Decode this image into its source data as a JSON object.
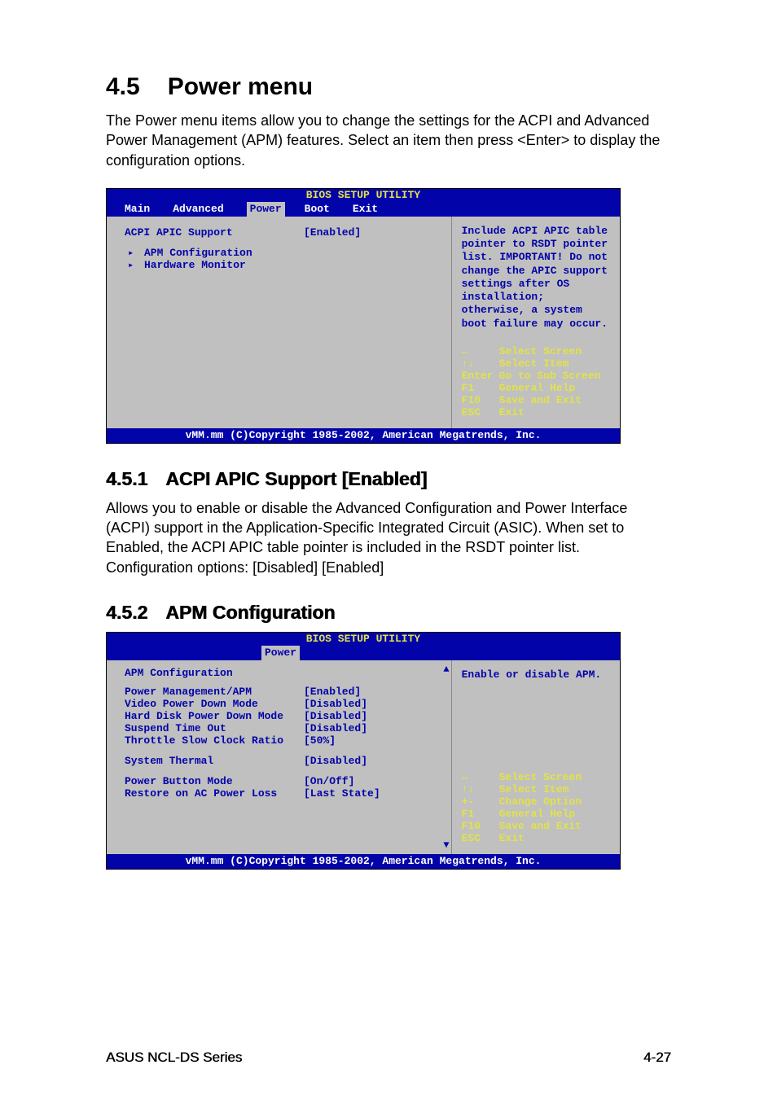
{
  "heading": {
    "number": "4.5",
    "title": "Power menu"
  },
  "intro": "The Power menu items allow you to change the settings for the ACPI and Advanced Power Management (APM) features. Select an item then press <Enter> to display the configuration options.",
  "bios1": {
    "title": "BIOS SETUP UTILITY",
    "tabs": {
      "t0": "Main",
      "t1": "Advanced",
      "t2": "Power",
      "t3": "Boot",
      "t4": "Exit",
      "active": "Power"
    },
    "items": {
      "acpi_label": "ACPI APIC Support",
      "acpi_value": "[Enabled]",
      "sub0": "APM Configuration",
      "sub1": "Hardware Monitor"
    },
    "help": "Include ACPI APIC table pointer to RSDT pointer list. IMPORTANT! Do not change the APIC support settings after OS installation; otherwise, a system boot failure may occur.",
    "nav": {
      "k0": "↔",
      "d0": "Select Screen",
      "k1": "↑↓",
      "d1": "Select Item",
      "k2": "Enter",
      "d2": "Go to Sub Screen",
      "k3": "F1",
      "d3": "General Help",
      "k4": "F10",
      "d4": "Save and Exit",
      "k5": "ESC",
      "d5": "Exit"
    },
    "footer": "vMM.mm (C)Copyright 1985-2002, American Megatrends, Inc."
  },
  "section451": {
    "number": "4.5.1",
    "title": "ACPI APIC Support [Enabled]",
    "body": "Allows you to enable or disable the Advanced Configuration and Power Interface (ACPI) support in the Application-Specific Integrated Circuit (ASIC). When set to Enabled, the ACPI APIC table pointer is included in the RSDT pointer list. Configuration options: [Disabled] [Enabled]"
  },
  "section452": {
    "number": "4.5.2",
    "title": "APM Configuration"
  },
  "bios2": {
    "title": "BIOS SETUP UTILITY",
    "tab": "Power",
    "header": "APM Configuration",
    "items": {
      "l0": "Power Management/APM",
      "v0": "[Enabled]",
      "l1": "Video Power Down Mode",
      "v1": "[Disabled]",
      "l2": "Hard Disk Power Down Mode",
      "v2": "[Disabled]",
      "l3": "Suspend Time Out",
      "v3": "[Disabled]",
      "l4": "Throttle Slow Clock Ratio",
      "v4": "[50%]",
      "l5": "System Thermal",
      "v5": "[Disabled]",
      "l6": "Power Button Mode",
      "v6": "[On/Off]",
      "l7": "Restore on AC Power Loss",
      "v7": "[Last State]"
    },
    "help": "Enable or disable APM.",
    "nav": {
      "k0": "↔",
      "d0": "Select Screen",
      "k1": "↑↓",
      "d1": "Select Item",
      "k2": "+-",
      "d2": "Change Option",
      "k3": "F1",
      "d3": "General Help",
      "k4": "F10",
      "d4": "Save and Exit",
      "k5": "ESC",
      "d5": "Exit"
    },
    "footer": "vMM.mm (C)Copyright 1985-2002, American Megatrends, Inc."
  },
  "page_footer": {
    "left": "ASUS NCL-DS Series",
    "right": "4-27"
  }
}
